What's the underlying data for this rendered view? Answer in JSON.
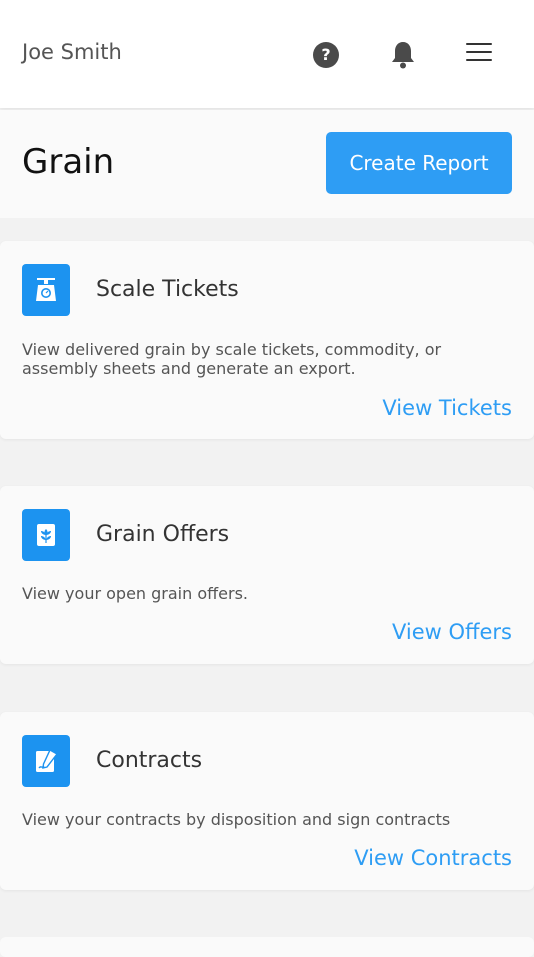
{
  "header": {
    "user_name": "Joe Smith",
    "help_glyph": "?",
    "icons": [
      "help-icon",
      "bell-icon",
      "menu-icon"
    ]
  },
  "page": {
    "title": "Grain",
    "create_button_label": "Create Report",
    "accent_color": "#2e9df4"
  },
  "cards": [
    {
      "icon": "scale-icon",
      "title": "Scale Tickets",
      "description": "View delivered grain by scale tickets, commodity, or assembly sheets and generate an export.",
      "link_label": "View Tickets"
    },
    {
      "icon": "grain-icon",
      "title": "Grain Offers",
      "description": "View your open grain offers.",
      "link_label": "View Offers"
    },
    {
      "icon": "contract-sign-icon",
      "title": "Contracts",
      "description": "View your contracts by disposition and sign contracts",
      "link_label": "View Contracts"
    }
  ]
}
